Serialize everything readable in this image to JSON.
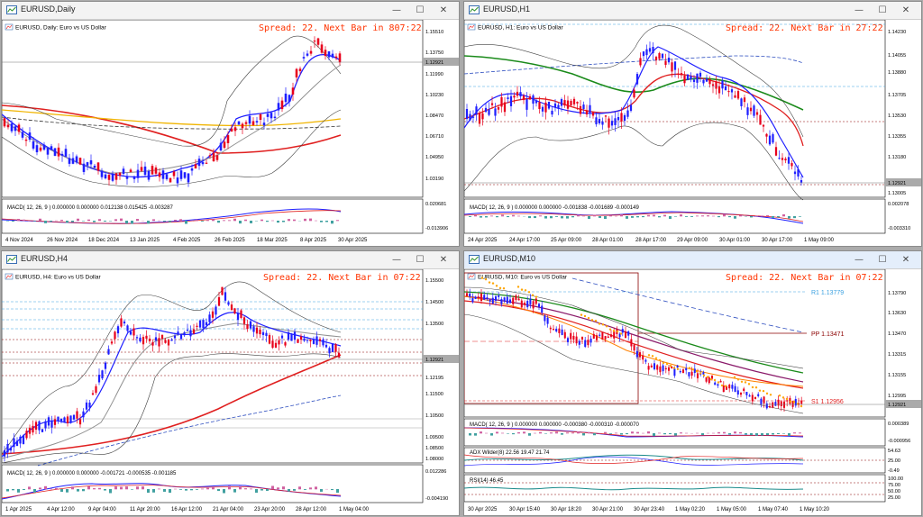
{
  "charts": [
    {
      "key": "daily",
      "window_title": "EURUSD,Daily",
      "symbol_label": "EURUSD, Daily:  Euro vs US Dollar",
      "spread_text": "Spread: 22. Next Bar in 807:22",
      "price_ticks": [
        "1.15510",
        "1.13750",
        "1.11990",
        "1.10230",
        "1.08470",
        "1.06710",
        "1.04950",
        "1.03190"
      ],
      "price_label": "1.12921",
      "date_ticks": [
        "4 Nov 2024",
        "26 Nov 2024",
        "18 Dec 2024",
        "13 Jan 2025",
        "4 Feb 2025",
        "26 Feb 2025",
        "18 Mar 2025",
        "8 Apr 2025",
        "30 Apr 2025"
      ],
      "macd_label": "MACD( 12, 26, 9 )  0.000000 0.000000 0.012138 0.015425 -0.003287",
      "macd_ticks": [
        "0.020681",
        "-0.013906"
      ]
    },
    {
      "key": "h1",
      "window_title": "EURUSD,H1",
      "symbol_label": "EURUSD, H1:  Euro vs US Dollar",
      "spread_text": "Spread: 22. Next Bar in 27:22",
      "price_ticks": [
        "1.14230",
        "1.14055",
        "1.13880",
        "1.13705",
        "1.13530",
        "1.13355",
        "1.13180",
        "1.13005"
      ],
      "price_label": "1.12921",
      "date_ticks": [
        "24 Apr 2025",
        "24 Apr 17:00",
        "25 Apr 09:00",
        "28 Apr 01:00",
        "28 Apr 17:00",
        "29 Apr 09:00",
        "30 Apr 01:00",
        "30 Apr 17:00",
        "1 May 09:00"
      ],
      "macd_label": "MACD( 12, 26, 9 )  0.000000 0.000000 -0.001838 -0.001689 -0.000149",
      "macd_ticks": [
        "0.002078",
        "-0.003310"
      ]
    },
    {
      "key": "h4",
      "window_title": "EURUSD,H4",
      "symbol_label": "EURUSD, H4:  Euro vs US Dollar",
      "spread_text": "Spread: 22. Next Bar in 07:22",
      "price_ticks": [
        "1.15500",
        "1.14500",
        "1.13500",
        "1.12195",
        "1.11500",
        "1.10500",
        "1.09500",
        "1.08500",
        "1.08000"
      ],
      "price_label": "1.12921",
      "date_ticks": [
        "1 Apr 2025",
        "4 Apr 12:00",
        "9 Apr 04:00",
        "11 Apr 20:00",
        "16 Apr 12:00",
        "21 Apr 04:00",
        "23 Apr 20:00",
        "28 Apr 12:00",
        "1 May 04:00"
      ],
      "macd_label": "MACD( 12, 26, 9 )  0.000000 0.000000 -0.001721 -0.000535 -0.001185",
      "macd_ticks": [
        "0.012286",
        "-0.004190"
      ]
    },
    {
      "key": "m10",
      "window_title": "EURUSD,M10",
      "symbol_label": "EURUSD, M10:  Euro vs US Dollar",
      "spread_text": "Spread: 22. Next Bar in 07:22",
      "price_ticks": [
        "1.13790",
        "1.13630",
        "1.13470",
        "1.13315",
        "1.13155",
        "1.12995"
      ],
      "price_label": "1.12921",
      "r1_label": "R1 1.13779",
      "pp_label": "PP 1.13471",
      "s1_label": "S1 1.12956",
      "date_ticks": [
        "30 Apr 2025",
        "30 Apr 15:40",
        "30 Apr 18:20",
        "30 Apr 21:00",
        "30 Apr 23:40",
        "1 May 02:20",
        "1 May 05:00",
        "1 May 07:40",
        "1 May 10:20"
      ],
      "macd_label": "MACD( 12, 26, 9 )  0.000000 0.000000 -0.000380 -0.000310 -0.000070",
      "macd_ticks": [
        "0.000389",
        "-0.000956"
      ],
      "adx_label": "ADX Wilder(8) 22.56 19.47 21.74",
      "adx_ticks": [
        "54.63",
        "25.00",
        "-0.49"
      ],
      "rsi_label": "RSI(14) 46.45",
      "rsi_ticks": [
        "100.00",
        "75.00",
        "50.00",
        "25.00"
      ]
    }
  ],
  "window_buttons": {
    "minimize": "—",
    "maximize": "☐",
    "close": "✕"
  },
  "colors": {
    "spread": "#ff3300",
    "bull": "#1f1fff",
    "bear": "#e8001c",
    "ma_slow": "#e02020",
    "ma_green": "#1a8a1a",
    "bands": "#404040"
  }
}
